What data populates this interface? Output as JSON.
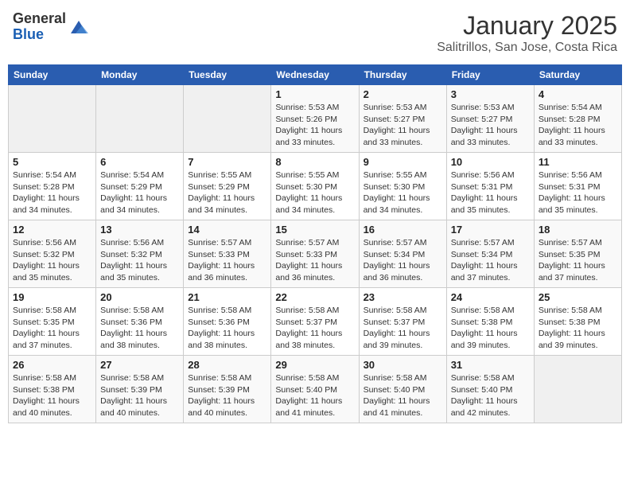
{
  "header": {
    "logo_general": "General",
    "logo_blue": "Blue",
    "month_title": "January 2025",
    "subtitle": "Salitrillos, San Jose, Costa Rica"
  },
  "days_of_week": [
    "Sunday",
    "Monday",
    "Tuesday",
    "Wednesday",
    "Thursday",
    "Friday",
    "Saturday"
  ],
  "weeks": [
    [
      {
        "day": "",
        "detail": ""
      },
      {
        "day": "",
        "detail": ""
      },
      {
        "day": "",
        "detail": ""
      },
      {
        "day": "1",
        "detail": "Sunrise: 5:53 AM\nSunset: 5:26 PM\nDaylight: 11 hours and 33 minutes."
      },
      {
        "day": "2",
        "detail": "Sunrise: 5:53 AM\nSunset: 5:27 PM\nDaylight: 11 hours and 33 minutes."
      },
      {
        "day": "3",
        "detail": "Sunrise: 5:53 AM\nSunset: 5:27 PM\nDaylight: 11 hours and 33 minutes."
      },
      {
        "day": "4",
        "detail": "Sunrise: 5:54 AM\nSunset: 5:28 PM\nDaylight: 11 hours and 33 minutes."
      }
    ],
    [
      {
        "day": "5",
        "detail": "Sunrise: 5:54 AM\nSunset: 5:28 PM\nDaylight: 11 hours and 34 minutes."
      },
      {
        "day": "6",
        "detail": "Sunrise: 5:54 AM\nSunset: 5:29 PM\nDaylight: 11 hours and 34 minutes."
      },
      {
        "day": "7",
        "detail": "Sunrise: 5:55 AM\nSunset: 5:29 PM\nDaylight: 11 hours and 34 minutes."
      },
      {
        "day": "8",
        "detail": "Sunrise: 5:55 AM\nSunset: 5:30 PM\nDaylight: 11 hours and 34 minutes."
      },
      {
        "day": "9",
        "detail": "Sunrise: 5:55 AM\nSunset: 5:30 PM\nDaylight: 11 hours and 34 minutes."
      },
      {
        "day": "10",
        "detail": "Sunrise: 5:56 AM\nSunset: 5:31 PM\nDaylight: 11 hours and 35 minutes."
      },
      {
        "day": "11",
        "detail": "Sunrise: 5:56 AM\nSunset: 5:31 PM\nDaylight: 11 hours and 35 minutes."
      }
    ],
    [
      {
        "day": "12",
        "detail": "Sunrise: 5:56 AM\nSunset: 5:32 PM\nDaylight: 11 hours and 35 minutes."
      },
      {
        "day": "13",
        "detail": "Sunrise: 5:56 AM\nSunset: 5:32 PM\nDaylight: 11 hours and 35 minutes."
      },
      {
        "day": "14",
        "detail": "Sunrise: 5:57 AM\nSunset: 5:33 PM\nDaylight: 11 hours and 36 minutes."
      },
      {
        "day": "15",
        "detail": "Sunrise: 5:57 AM\nSunset: 5:33 PM\nDaylight: 11 hours and 36 minutes."
      },
      {
        "day": "16",
        "detail": "Sunrise: 5:57 AM\nSunset: 5:34 PM\nDaylight: 11 hours and 36 minutes."
      },
      {
        "day": "17",
        "detail": "Sunrise: 5:57 AM\nSunset: 5:34 PM\nDaylight: 11 hours and 37 minutes."
      },
      {
        "day": "18",
        "detail": "Sunrise: 5:57 AM\nSunset: 5:35 PM\nDaylight: 11 hours and 37 minutes."
      }
    ],
    [
      {
        "day": "19",
        "detail": "Sunrise: 5:58 AM\nSunset: 5:35 PM\nDaylight: 11 hours and 37 minutes."
      },
      {
        "day": "20",
        "detail": "Sunrise: 5:58 AM\nSunset: 5:36 PM\nDaylight: 11 hours and 38 minutes."
      },
      {
        "day": "21",
        "detail": "Sunrise: 5:58 AM\nSunset: 5:36 PM\nDaylight: 11 hours and 38 minutes."
      },
      {
        "day": "22",
        "detail": "Sunrise: 5:58 AM\nSunset: 5:37 PM\nDaylight: 11 hours and 38 minutes."
      },
      {
        "day": "23",
        "detail": "Sunrise: 5:58 AM\nSunset: 5:37 PM\nDaylight: 11 hours and 39 minutes."
      },
      {
        "day": "24",
        "detail": "Sunrise: 5:58 AM\nSunset: 5:38 PM\nDaylight: 11 hours and 39 minutes."
      },
      {
        "day": "25",
        "detail": "Sunrise: 5:58 AM\nSunset: 5:38 PM\nDaylight: 11 hours and 39 minutes."
      }
    ],
    [
      {
        "day": "26",
        "detail": "Sunrise: 5:58 AM\nSunset: 5:38 PM\nDaylight: 11 hours and 40 minutes."
      },
      {
        "day": "27",
        "detail": "Sunrise: 5:58 AM\nSunset: 5:39 PM\nDaylight: 11 hours and 40 minutes."
      },
      {
        "day": "28",
        "detail": "Sunrise: 5:58 AM\nSunset: 5:39 PM\nDaylight: 11 hours and 40 minutes."
      },
      {
        "day": "29",
        "detail": "Sunrise: 5:58 AM\nSunset: 5:40 PM\nDaylight: 11 hours and 41 minutes."
      },
      {
        "day": "30",
        "detail": "Sunrise: 5:58 AM\nSunset: 5:40 PM\nDaylight: 11 hours and 41 minutes."
      },
      {
        "day": "31",
        "detail": "Sunrise: 5:58 AM\nSunset: 5:40 PM\nDaylight: 11 hours and 42 minutes."
      },
      {
        "day": "",
        "detail": ""
      }
    ]
  ]
}
